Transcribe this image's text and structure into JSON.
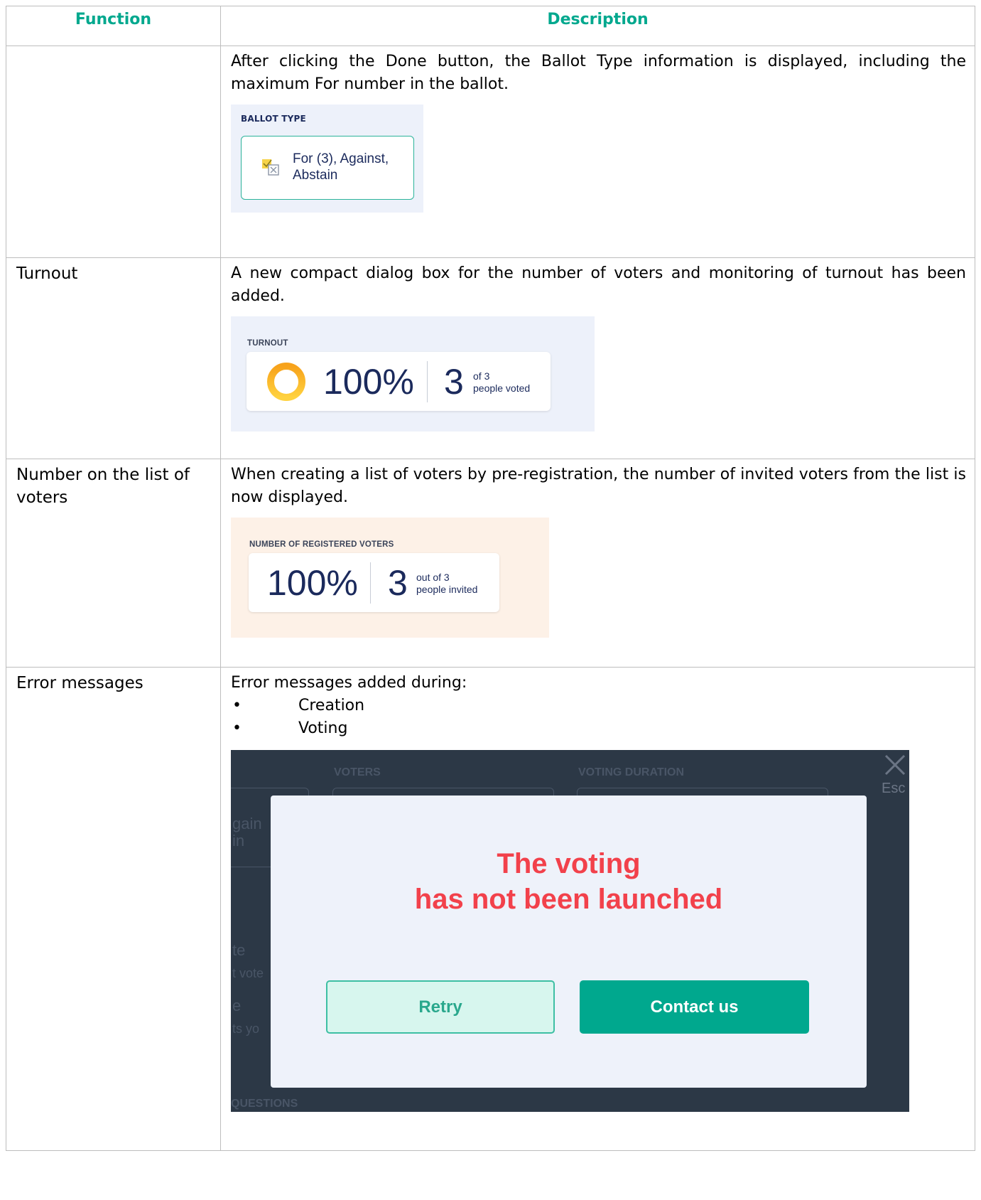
{
  "table": {
    "header_function": "Function",
    "header_description": "Description"
  },
  "row1": {
    "function": "",
    "desc_parts": [
      "After clicking the ",
      "Done",
      " button, the ",
      "Ballot Type",
      " information is displayed, including the maximum ",
      "For",
      " number in the ballot."
    ],
    "panel": {
      "label": "BALLOT TYPE",
      "icon": "ballot-checkbox-icon",
      "option_line1": "For (3), Against,",
      "option_line2": "Abstain"
    }
  },
  "row2": {
    "function": "Turnout",
    "description": "A new compact dialog box for the number of voters and monitoring of turnout has been added.",
    "panel": {
      "label": "TURNOUT",
      "percent": "100%",
      "count": "3",
      "of_text": "of 3",
      "voted_text": "people voted",
      "ring_color": "#f5a623"
    }
  },
  "row3": {
    "function": "Number on the list of voters",
    "desc_parts": [
      "When creating a list of voters by ",
      "pre-registration",
      ", the number of invited voters from the list is now displayed."
    ],
    "panel": {
      "label": "NUMBER OF REGISTERED VOTERS",
      "percent": "100%",
      "count": "3",
      "of_text": "out of 3",
      "invited_text": "people invited"
    }
  },
  "row4": {
    "function": "Error messages",
    "description": "Error messages added during:",
    "bullets": [
      "Creation",
      "Voting"
    ],
    "screenshot": {
      "bg_label_voters": "VOTERS",
      "bg_label_duration": "VOTING DURATION",
      "bg_label_questions": "QUESTIONS",
      "bg_frag_1": "gain",
      "bg_frag_2": "in",
      "bg_frag_3": "te",
      "bg_frag_4": "t vote",
      "bg_frag_5": "e",
      "bg_frag_6": "ts yo",
      "close_label": "Esc",
      "title_line1": "The voting",
      "title_line2": "has not been launched",
      "retry_label": "Retry",
      "contact_label": "Contact us",
      "accent": "#00a88e",
      "error_color": "#f2414b"
    }
  }
}
